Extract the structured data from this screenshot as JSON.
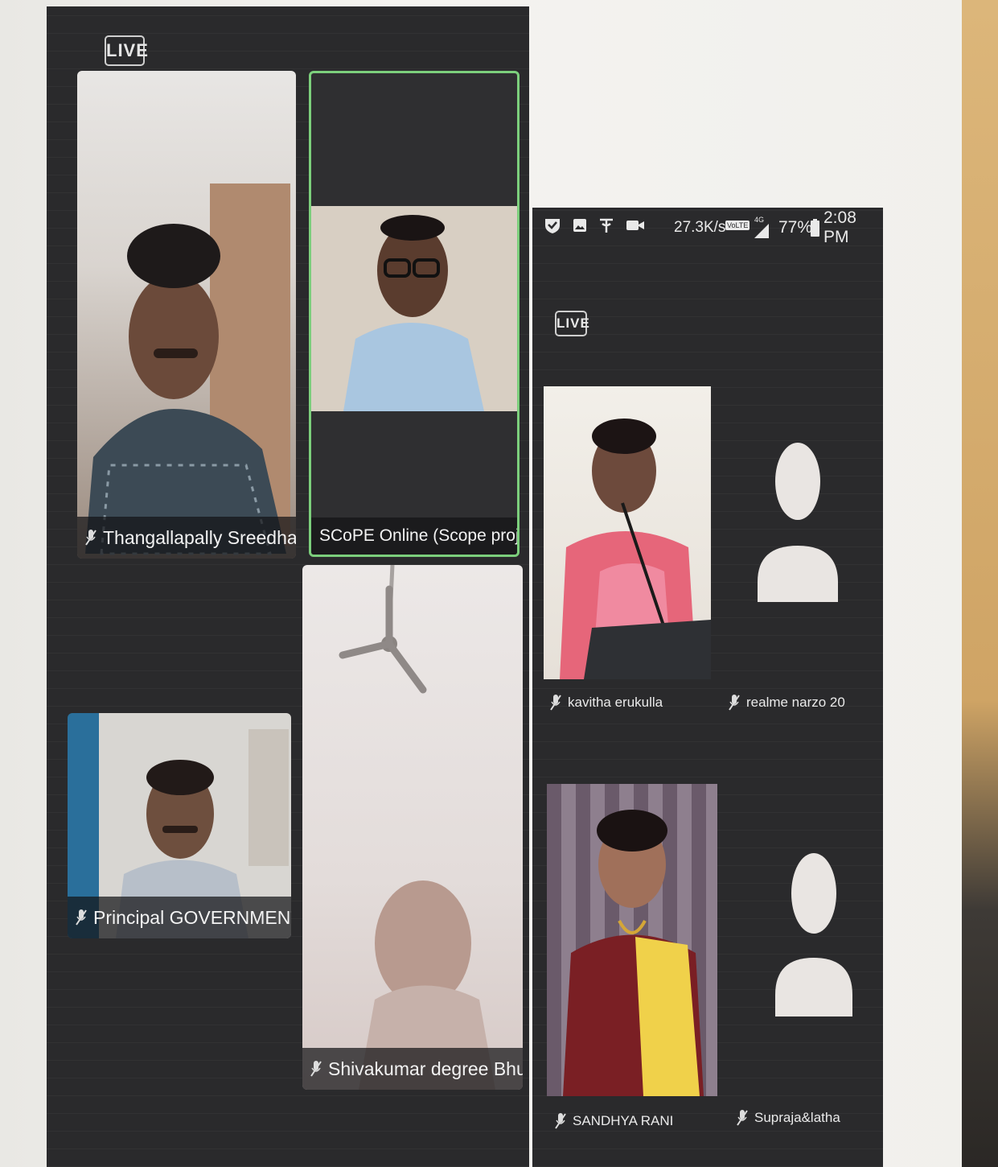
{
  "left_screen": {
    "live_badge": "LIVE",
    "participants": [
      {
        "name": "Thangallapally Sreedhar"
      },
      {
        "name": "SCoPE Online (Scope project; V..."
      },
      {
        "name": "Principal GOVERNMENT DE..."
      },
      {
        "name": "Shivakumar degree Bhupal..."
      }
    ]
  },
  "right_screen": {
    "status_bar": {
      "speed": "27.3K/s",
      "network": "VoLTE",
      "signal": "4G",
      "battery": "77%",
      "time": "2:08 PM"
    },
    "live_badge": "LIVE",
    "participants": [
      {
        "name": "kavitha erukulla"
      },
      {
        "name": "realme narzo 20"
      },
      {
        "name": "SANDHYA RANI"
      },
      {
        "name": "Supraja&latha"
      }
    ]
  },
  "colors": {
    "screen_bg": "#2a2a2c",
    "active_speaker_border": "#7ccf7c",
    "avatar_placeholder": "#e9e5e2"
  }
}
